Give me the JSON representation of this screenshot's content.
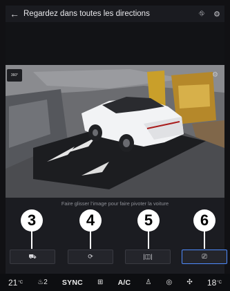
{
  "header": {
    "back_icon": "←",
    "title": "Regardez dans toutes les directions",
    "camera_icon": "⛗",
    "settings_icon": "⚙"
  },
  "view": {
    "badge_label": "360°",
    "settings_icon": "⚙"
  },
  "hint": "Faire glisser l’image pour faire pivoter la voiture",
  "callouts": [
    "3",
    "4",
    "5",
    "6"
  ],
  "modes": [
    {
      "name": "front-view",
      "icon": "⛟"
    },
    {
      "name": "rear-view",
      "icon": "⟳"
    },
    {
      "name": "side-view",
      "icon": "|◫|"
    },
    {
      "name": "camera-view",
      "icon": "⎚"
    }
  ],
  "status_bar": {
    "temp_left": "21",
    "temp_left_unit": "°C",
    "seat_level": "2",
    "sync": "SYNC",
    "ac": "A/C",
    "temp_right": "18",
    "temp_right_unit": "°C"
  },
  "colors": {
    "accent": "#4f8cff",
    "background": "#111114",
    "panel": "#1b1c21"
  }
}
